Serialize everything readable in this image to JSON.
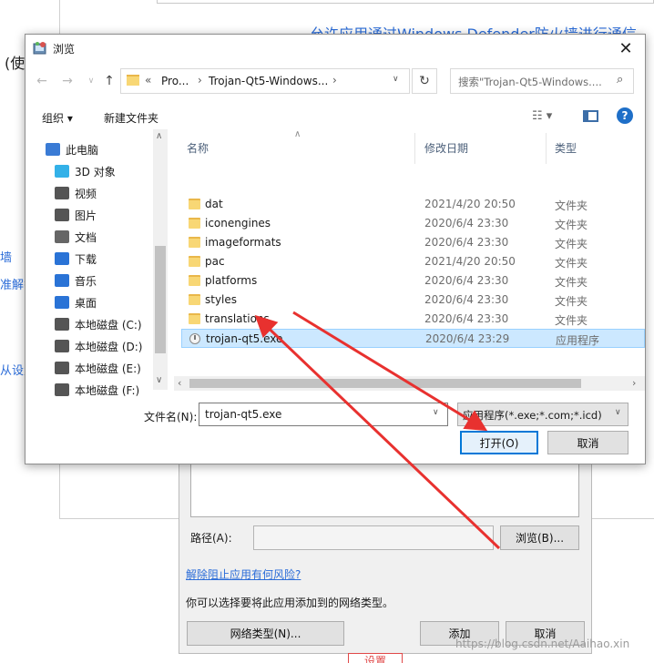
{
  "background": {
    "heading_partial": "允许应用通过Windows Defender防火墙进行通信",
    "left_partial": "(使",
    "left_links": [
      "墙",
      "准解答",
      "从设置"
    ]
  },
  "lower_dialog": {
    "path_label": "路径(A):",
    "path_value": "",
    "browse_button": "浏览(B)...",
    "risk_link": "解除阻止应用有何风险?",
    "network_desc": "你可以选择要将此应用添加到的网络类型。",
    "network_type_button": "网络类型(N)...",
    "add_button": "添加",
    "cancel_button": "取消",
    "bottom_partial": "设置",
    "watermark": "https://blog.csdn.net/Aaihao.xin"
  },
  "browse_dialog": {
    "title": "浏览",
    "close_icon": "close-icon",
    "address": {
      "chevrons": "«",
      "crumbs": [
        "Pro...",
        "Trojan-Qt5-Windows..."
      ]
    },
    "search_placeholder": "搜索\"Trojan-Qt5-Windows....",
    "toolbar": {
      "organize": "组织 ▾",
      "new_folder": "新建文件夹"
    },
    "nav_items": [
      {
        "label": "此电脑",
        "icon": "computer-icon",
        "indent": 0,
        "color": "#3a7bd5"
      },
      {
        "label": "3D 对象",
        "icon": "cube-icon",
        "indent": 1,
        "color": "#33b1e8"
      },
      {
        "label": "视频",
        "icon": "video-icon",
        "indent": 1,
        "color": "#555555"
      },
      {
        "label": "图片",
        "icon": "picture-icon",
        "indent": 1,
        "color": "#555555"
      },
      {
        "label": "文档",
        "icon": "document-icon",
        "indent": 1,
        "color": "#666666"
      },
      {
        "label": "下载",
        "icon": "download-icon",
        "indent": 1,
        "color": "#2a73d6"
      },
      {
        "label": "音乐",
        "icon": "music-icon",
        "indent": 1,
        "color": "#2a73d6"
      },
      {
        "label": "桌面",
        "icon": "desktop-icon",
        "indent": 1,
        "color": "#2a73d6"
      },
      {
        "label": "本地磁盘 (C:)",
        "icon": "drive-c-icon",
        "indent": 1,
        "color": "#555555"
      },
      {
        "label": "本地磁盘 (D:)",
        "icon": "drive-icon",
        "indent": 1,
        "color": "#555555"
      },
      {
        "label": "本地磁盘 (E:)",
        "icon": "drive-icon",
        "indent": 1,
        "color": "#555555"
      },
      {
        "label": "本地磁盘 (F:)",
        "icon": "drive-icon",
        "indent": 1,
        "color": "#555555"
      }
    ],
    "columns": {
      "name": "名称",
      "date": "修改日期",
      "type": "类型"
    },
    "files": [
      {
        "name": "dat",
        "date": "2021/4/20 20:50",
        "type": "文件夹",
        "kind": "folder"
      },
      {
        "name": "iconengines",
        "date": "2020/6/4 23:30",
        "type": "文件夹",
        "kind": "folder"
      },
      {
        "name": "imageformats",
        "date": "2020/6/4 23:30",
        "type": "文件夹",
        "kind": "folder"
      },
      {
        "name": "pac",
        "date": "2021/4/20 20:50",
        "type": "文件夹",
        "kind": "folder"
      },
      {
        "name": "platforms",
        "date": "2020/6/4 23:30",
        "type": "文件夹",
        "kind": "folder"
      },
      {
        "name": "styles",
        "date": "2020/6/4 23:30",
        "type": "文件夹",
        "kind": "folder"
      },
      {
        "name": "translations",
        "date": "2020/6/4 23:30",
        "type": "文件夹",
        "kind": "folder"
      },
      {
        "name": "trojan-qt5.exe",
        "date": "2020/6/4 23:29",
        "type": "应用程序",
        "kind": "exe",
        "selected": true
      }
    ],
    "filename_label": "文件名(N):",
    "filename_value": "trojan-qt5.exe",
    "filetype_value": "应用程序(*.exe;*.com;*.icd)",
    "open_button": "打开(O)",
    "cancel_button": "取消"
  },
  "colors": {
    "accent": "#0078d7",
    "selection": "#cce8ff",
    "annotation_arrow": "#e8312f",
    "link": "#2b6cd8"
  }
}
